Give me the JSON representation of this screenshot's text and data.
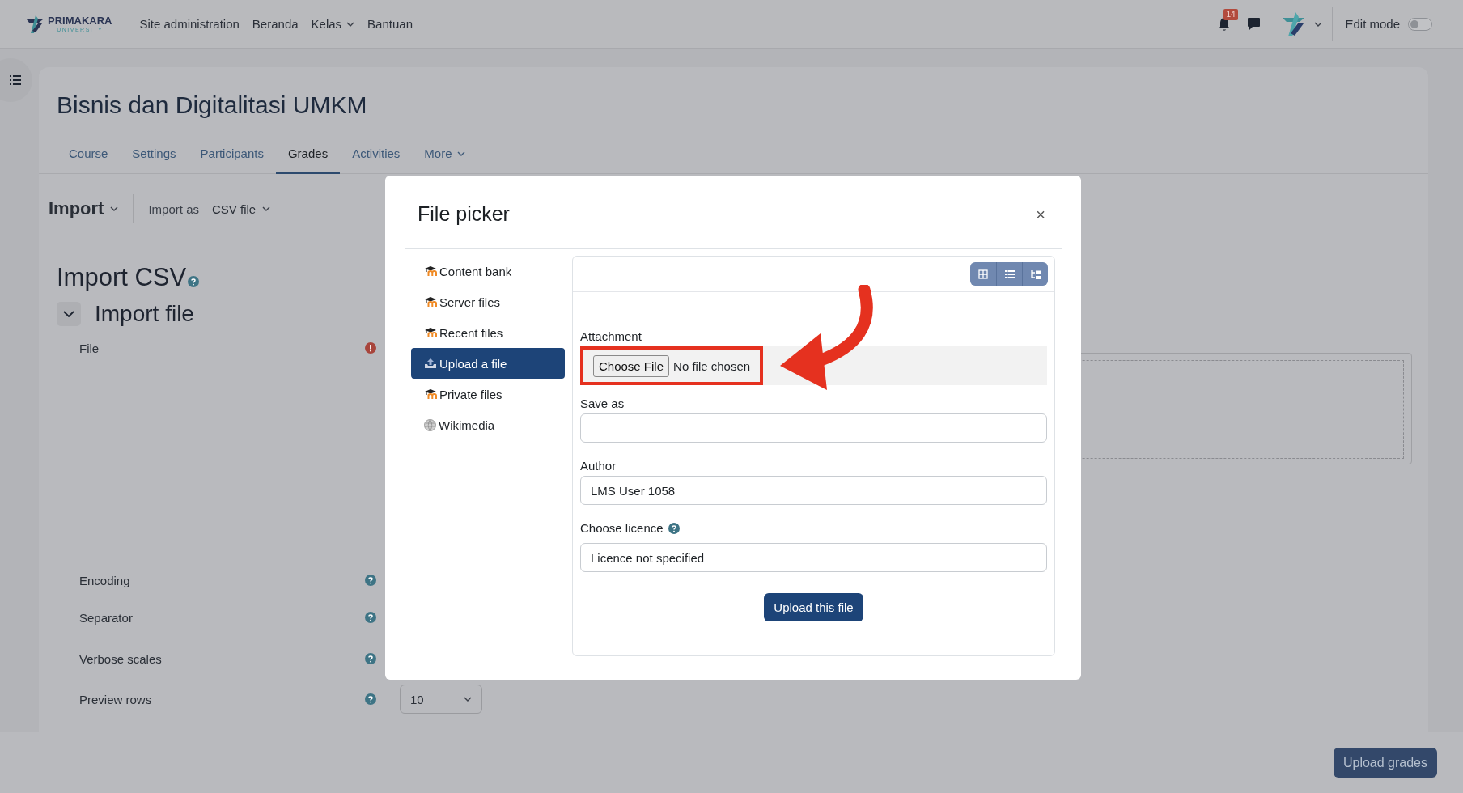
{
  "navbar": {
    "logo": {
      "name": "PRIMAKARA",
      "tagline": "UNIVERSITY"
    },
    "links": [
      {
        "label": "Site administration",
        "dropdown": false
      },
      {
        "label": "Beranda",
        "dropdown": false
      },
      {
        "label": "Kelas",
        "dropdown": true
      },
      {
        "label": "Bantuan",
        "dropdown": false
      }
    ],
    "notification_count": "14",
    "edit_mode": {
      "label": "Edit mode",
      "on": false
    }
  },
  "course": {
    "title": "Bisnis dan Digitalitasi UMKM",
    "tabs": [
      {
        "label": "Course",
        "selected": false,
        "dropdown": false
      },
      {
        "label": "Settings",
        "selected": false,
        "dropdown": false
      },
      {
        "label": "Participants",
        "selected": false,
        "dropdown": false
      },
      {
        "label": "Grades",
        "selected": true,
        "dropdown": false
      },
      {
        "label": "Activities",
        "selected": false,
        "dropdown": false
      },
      {
        "label": "More",
        "selected": false,
        "dropdown": true
      }
    ]
  },
  "action_bar": {
    "heading": "Import",
    "import_as_label": "Import as",
    "import_as_value": "CSV file"
  },
  "form": {
    "title": "Import CSV",
    "section": {
      "title": "Import file",
      "expanded": true
    },
    "fields": [
      {
        "label": "File",
        "kind": "required"
      },
      {
        "label": "Encoding",
        "kind": "help"
      },
      {
        "label": "Separator",
        "kind": "help"
      },
      {
        "label": "Verbose scales",
        "kind": "help"
      },
      {
        "label": "Preview rows",
        "kind": "help",
        "value": "10"
      }
    ]
  },
  "footer": {
    "button": "Upload grades"
  },
  "file_picker": {
    "title": "File picker",
    "close": "×",
    "repositories": [
      {
        "label": "Content bank",
        "kind": "moodle",
        "selected": false
      },
      {
        "label": "Server files",
        "kind": "moodle",
        "selected": false
      },
      {
        "label": "Recent files",
        "kind": "moodle",
        "selected": false
      },
      {
        "label": "Upload a file",
        "kind": "upload",
        "selected": true
      },
      {
        "label": "Private files",
        "kind": "moodle",
        "selected": false
      },
      {
        "label": "Wikimedia",
        "kind": "globe",
        "selected": false
      }
    ],
    "attachment": {
      "label": "Attachment",
      "button": "Choose File",
      "status": "No file chosen",
      "highlighted": true
    },
    "save_as": {
      "label": "Save as"
    },
    "author": {
      "label": "Author",
      "value": "LMS User 1058"
    },
    "licence": {
      "label": "Choose licence",
      "value": "Licence not specified"
    },
    "upload_button": "Upload this file"
  }
}
